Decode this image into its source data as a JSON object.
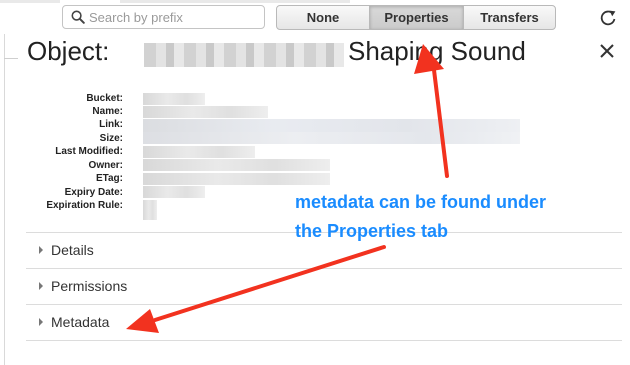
{
  "search": {
    "placeholder": "Search by prefix",
    "value": ""
  },
  "tabs": [
    {
      "label": "None",
      "active": false
    },
    {
      "label": "Properties",
      "active": true
    },
    {
      "label": "Transfers",
      "active": false
    }
  ],
  "header": {
    "title_prefix": "Object:",
    "title_suffix": "Shaping Sound"
  },
  "properties": [
    {
      "label": "Bucket:"
    },
    {
      "label": "Name:"
    },
    {
      "label": "Link:"
    },
    {
      "label": "Size:"
    },
    {
      "label": "Last Modified:"
    },
    {
      "label": "Owner:"
    },
    {
      "label": "ETag:"
    },
    {
      "label": "Expiry Date:"
    },
    {
      "label": "Expiration Rule:"
    }
  ],
  "sections": [
    {
      "label": "Details"
    },
    {
      "label": "Permissions"
    },
    {
      "label": "Metadata"
    }
  ],
  "annotation": {
    "line1": "metadata can be found under",
    "line2": "the Properties tab",
    "color": "#1a8cff"
  },
  "colors": {
    "arrow": "#f2321f",
    "accent_text": "#1a8cff"
  },
  "icons": {
    "search": "magnifier-icon",
    "refresh": "refresh-icon",
    "close": "close-icon",
    "expand": "caret-right-icon"
  }
}
